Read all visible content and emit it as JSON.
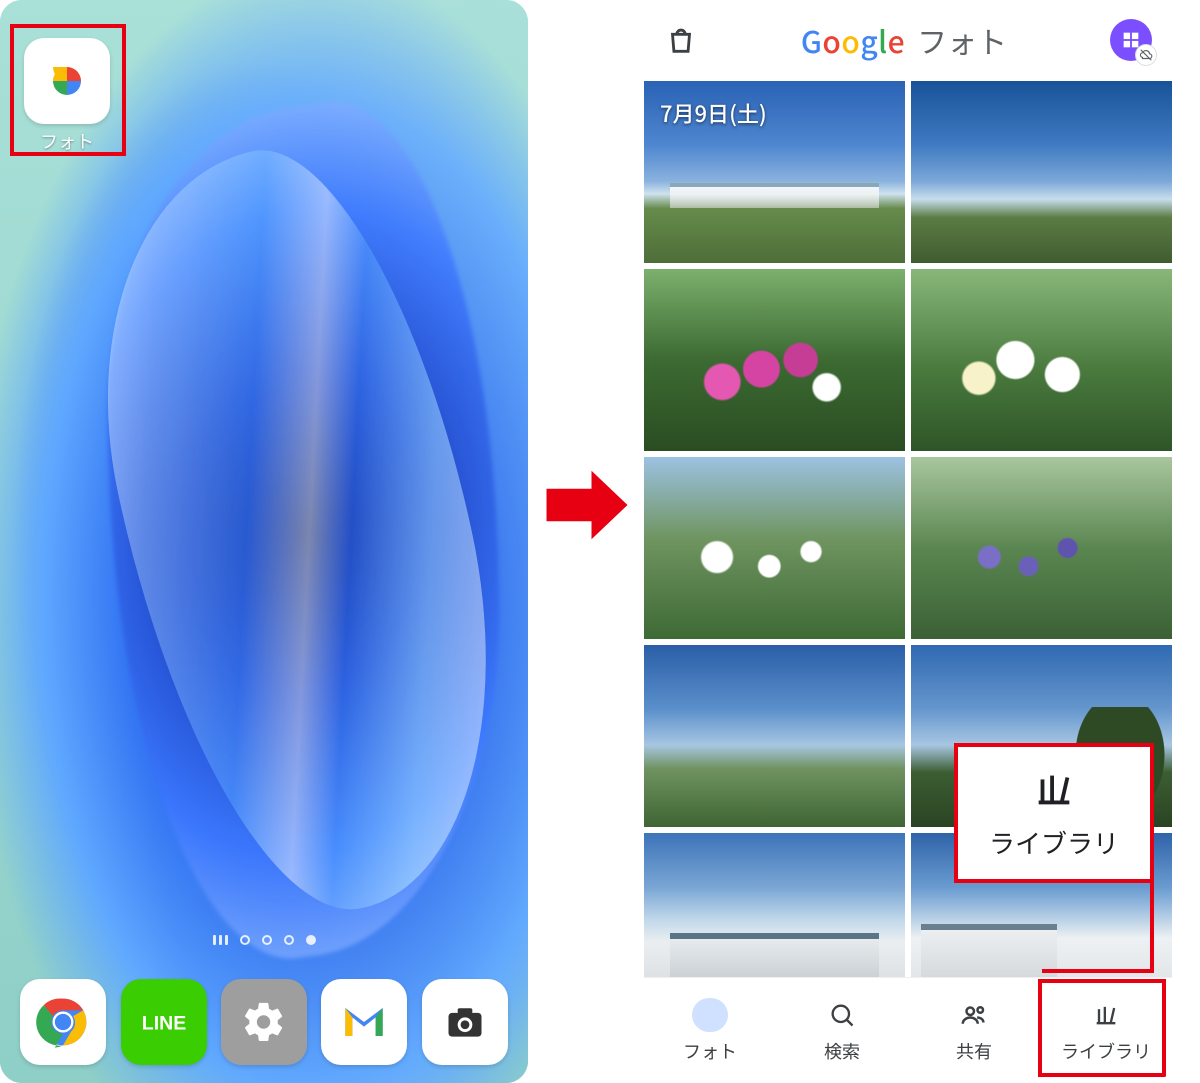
{
  "home": {
    "photos_app_label": "フォト",
    "dock": [
      "Chrome",
      "LINE",
      "設定",
      "Gmail",
      "カメラ"
    ]
  },
  "arrow": {
    "color": "#e60012"
  },
  "gphotos": {
    "header": {
      "brand_letters": [
        "G",
        "o",
        "o",
        "g",
        "l",
        "e"
      ],
      "title_jp": "フォト"
    },
    "date_label": "7月9日(土)",
    "library_callout": "ライブラリ",
    "nav": {
      "items": [
        {
          "label": "フォト",
          "icon": "image",
          "active": true
        },
        {
          "label": "検索",
          "icon": "search",
          "active": false
        },
        {
          "label": "共有",
          "icon": "people",
          "active": false
        },
        {
          "label": "ライブラリ",
          "icon": "library",
          "active": false
        }
      ]
    }
  }
}
